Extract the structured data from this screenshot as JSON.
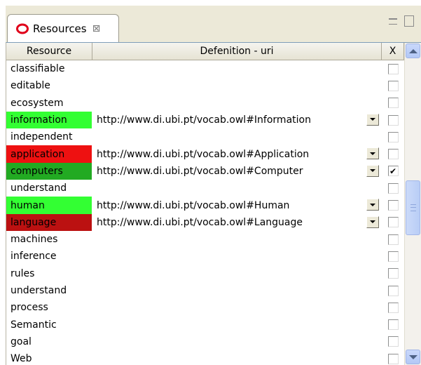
{
  "tab": {
    "label": "Resources",
    "close_glyph": "⊠",
    "icon": "resources-icon"
  },
  "table": {
    "headers": {
      "resource": "Resource",
      "definition": "Defenition - uri",
      "x": "X"
    },
    "rows": [
      {
        "resource": "classifiable",
        "uri": "",
        "color": "",
        "checked": false
      },
      {
        "resource": "editable",
        "uri": "",
        "color": "",
        "checked": false
      },
      {
        "resource": "ecosystem",
        "uri": "",
        "color": "",
        "checked": false
      },
      {
        "resource": "information",
        "uri": "http://www.di.ubi.pt/vocab.owl#Information",
        "color": "#33ff33",
        "checked": false
      },
      {
        "resource": "independent",
        "uri": "",
        "color": "",
        "checked": false
      },
      {
        "resource": "application",
        "uri": "http://www.di.ubi.pt/vocab.owl#Application",
        "color": "#ee1111",
        "checked": false
      },
      {
        "resource": "computers",
        "uri": "http://www.di.ubi.pt/vocab.owl#Computer",
        "color": "#22aa22",
        "checked": true
      },
      {
        "resource": "understand",
        "uri": "",
        "color": "",
        "checked": false
      },
      {
        "resource": "human",
        "uri": "http://www.di.ubi.pt/vocab.owl#Human",
        "color": "#33ff33",
        "checked": false
      },
      {
        "resource": "language",
        "uri": "http://www.di.ubi.pt/vocab.owl#Language",
        "color": "#bb1111",
        "checked": false
      },
      {
        "resource": "machines",
        "uri": "",
        "color": "",
        "checked": false
      },
      {
        "resource": "inference",
        "uri": "",
        "color": "",
        "checked": false
      },
      {
        "resource": "rules",
        "uri": "",
        "color": "",
        "checked": false
      },
      {
        "resource": "understand",
        "uri": "",
        "color": "",
        "checked": false
      },
      {
        "resource": "process",
        "uri": "",
        "color": "",
        "checked": false
      },
      {
        "resource": "Semantic",
        "uri": "",
        "color": "",
        "checked": false
      },
      {
        "resource": "goal",
        "uri": "",
        "color": "",
        "checked": false
      },
      {
        "resource": "Web",
        "uri": "",
        "color": "",
        "checked": false
      }
    ]
  },
  "colors": {
    "frame": "#ece9d8",
    "tab_icon": "#e0001a",
    "scrollbar_thumb": "#c1d3fb"
  }
}
